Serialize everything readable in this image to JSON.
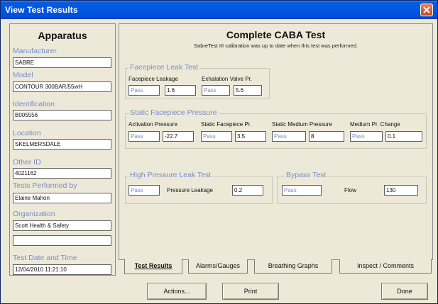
{
  "window": {
    "title": "View Test Results"
  },
  "apparatus": {
    "heading": "Apparatus",
    "fields": [
      {
        "label": "Manufacturer",
        "value": "SABRE"
      },
      {
        "label": "Model",
        "value": "CONTOUR 300BAR/55wH"
      },
      {
        "label": "Identification",
        "value": "B005556"
      },
      {
        "label": "Location",
        "value": "SKELMERSDALE"
      },
      {
        "label": "Other ID",
        "value": "4021162"
      },
      {
        "label": "Tests Performed by",
        "value": "Elaine Mahon"
      },
      {
        "label": "Organization",
        "value": "Scott Health & Safety",
        "value2": ""
      },
      {
        "label": "Test Date and Time",
        "value": "12/04/2010 11:21:10"
      }
    ]
  },
  "test": {
    "title": "Complete CABA Test",
    "subtitle": "SabreTest III calibration was up to date when this test was performed.",
    "facepiece_leak": {
      "title": "Facepiece Leak Test",
      "cols": [
        "Facepiece Leakage",
        "Exhalation Valve Pr."
      ],
      "status1": "Pass",
      "value1": "1.6",
      "status2": "Pass",
      "value2": "5.6"
    },
    "static_pressure": {
      "title": "Static Facepiece Pressure",
      "cols": [
        "Activation Pressure",
        "Static Facepiece Pr.",
        "Static Medium Pressure",
        "Medium Pr. Change"
      ],
      "items": [
        {
          "status": "Pass",
          "value": "-22.7"
        },
        {
          "status": "Pass",
          "value": "3.5"
        },
        {
          "status": "Pass",
          "value": "8"
        },
        {
          "status": "Pass",
          "value": "0.1"
        }
      ]
    },
    "high_pressure": {
      "title": "High Pressure Leak Test",
      "status": "Pass",
      "label": "Pressure Leakage",
      "value": "0.2"
    },
    "bypass": {
      "title": "Bypass Test",
      "status": "Pass",
      "label": "Flow",
      "value": "130"
    }
  },
  "tabs": [
    "Test Results",
    "Alarms/Gauges",
    "Breathing Graphs",
    "Inspect / Comments"
  ],
  "buttons": {
    "actions": "Actions...",
    "print": "Print",
    "done": "Done"
  }
}
